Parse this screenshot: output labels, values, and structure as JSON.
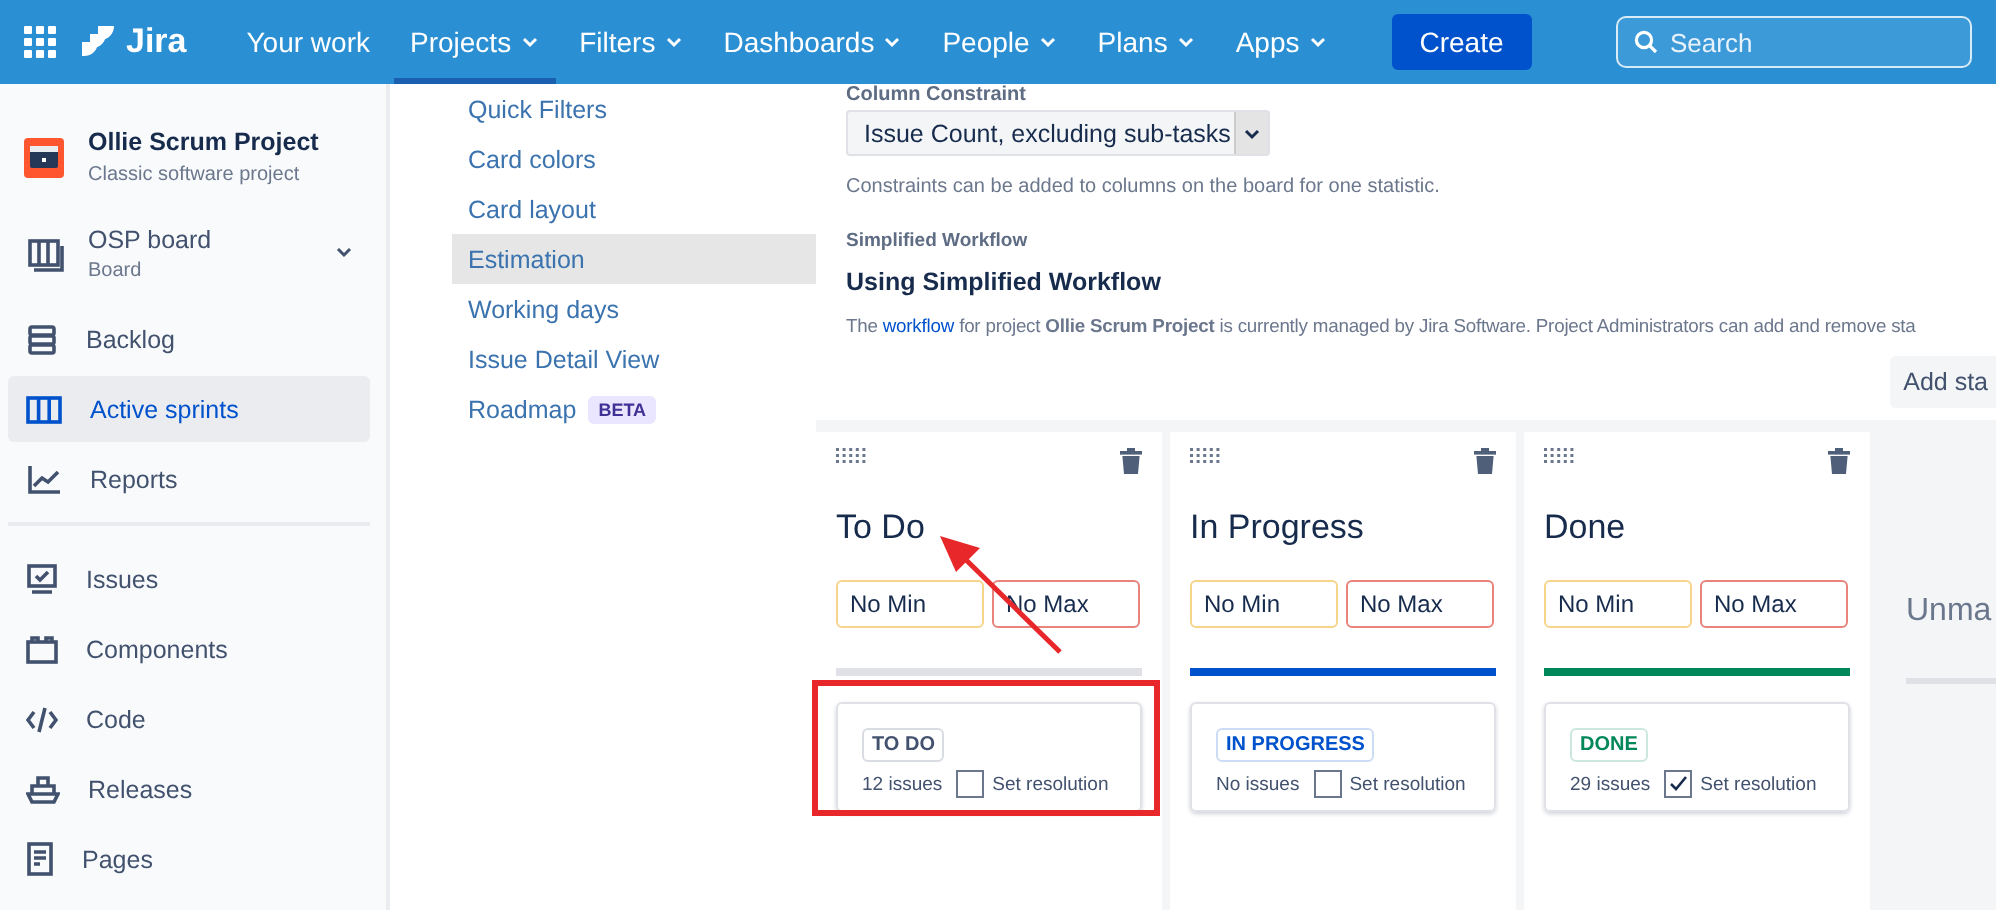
{
  "nav": {
    "logo": "Jira",
    "items": [
      {
        "label": "Your work",
        "dropdown": false,
        "selected": false
      },
      {
        "label": "Projects",
        "dropdown": true,
        "selected": true
      },
      {
        "label": "Filters",
        "dropdown": true,
        "selected": false
      },
      {
        "label": "Dashboards",
        "dropdown": true,
        "selected": false
      },
      {
        "label": "People",
        "dropdown": true,
        "selected": false
      },
      {
        "label": "Plans",
        "dropdown": true,
        "selected": false
      },
      {
        "label": "Apps",
        "dropdown": true,
        "selected": false
      }
    ],
    "create": "Create",
    "search": {
      "placeholder": "Search"
    }
  },
  "sidebar": {
    "project": {
      "name": "Ollie Scrum Project",
      "type": "Classic software project"
    },
    "board": {
      "name": "OSP board",
      "type": "Board"
    },
    "groups": [
      [
        {
          "label": "Backlog",
          "kind": "backlog",
          "selected": false
        },
        {
          "label": "Active sprints",
          "kind": "board",
          "selected": true
        },
        {
          "label": "Reports",
          "kind": "reports",
          "selected": false
        }
      ],
      [
        {
          "label": "Issues",
          "kind": "issues",
          "selected": false
        },
        {
          "label": "Components",
          "kind": "components",
          "selected": false
        },
        {
          "label": "Code",
          "kind": "code",
          "selected": false
        },
        {
          "label": "Releases",
          "kind": "releases",
          "selected": false
        },
        {
          "label": "Pages",
          "kind": "pages",
          "selected": false
        }
      ]
    ]
  },
  "settings_menu": [
    {
      "label": "Quick Filters",
      "selected": false
    },
    {
      "label": "Card colors",
      "selected": false
    },
    {
      "label": "Card layout",
      "selected": false
    },
    {
      "label": "Estimation",
      "selected": true
    },
    {
      "label": "Working days",
      "selected": false
    },
    {
      "label": "Issue Detail View",
      "selected": false
    },
    {
      "label": "Roadmap",
      "selected": false,
      "badge": "BETA"
    }
  ],
  "constraint": {
    "label": "Column Constraint",
    "value": "Issue Count, excluding sub-tasks",
    "help": "Constraints can be added to columns on the board for one statistic."
  },
  "workflow": {
    "section_label": "Simplified Workflow",
    "heading": "Using Simplified Workflow",
    "text_before": "The",
    "link": "workflow",
    "text_after": "for project **Ollie Scrum Project** is currently managed by Jira Software. Project Administrators can add and remove sta"
  },
  "add_status_button": "Add sta",
  "columns": [
    {
      "title": "To Do",
      "min": "No Min",
      "max": "No Max",
      "color": "#dfe1e6",
      "status": {
        "label": "TO DO",
        "color": "#42526e"
      },
      "count": "12 issues",
      "set_resolution": "Set resolution",
      "checked": false,
      "highlighted": true
    },
    {
      "title": "In Progress",
      "min": "No Min",
      "max": "No Max",
      "color": "#0052cc",
      "status": {
        "label": "IN PROGRESS",
        "color": "#0052cc"
      },
      "count": "No issues",
      "set_resolution": "Set resolution",
      "checked": false,
      "highlighted": false
    },
    {
      "title": "Done",
      "min": "No Min",
      "max": "No Max",
      "color": "#00875a",
      "status": {
        "label": "DONE",
        "color": "#00875a"
      },
      "count": "29 issues",
      "set_resolution": "Set resolution",
      "checked": true,
      "highlighted": false
    }
  ],
  "unmapped": {
    "title": "Unma"
  }
}
